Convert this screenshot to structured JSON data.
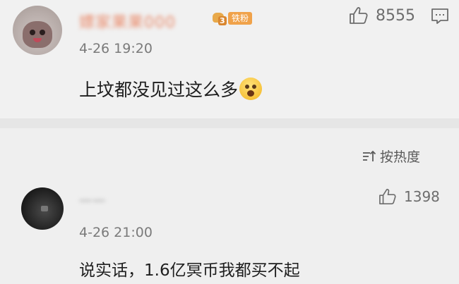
{
  "comments": [
    {
      "username": "嫖家果果000",
      "badge_level": "3",
      "badge_label": "铁粉",
      "time": "4-26 19:20",
      "text": "上坟都没见过这么多",
      "likes": "8555"
    },
    {
      "username": "一一",
      "time": "4-26 21:00",
      "text": "说实话，1.6亿冥币我都买不起",
      "likes": "1398"
    }
  ],
  "sort": {
    "label": "按热度"
  },
  "icons": {
    "like": "thumbs-up-icon",
    "more": "comment-menu-icon",
    "sort": "sort-icon",
    "emoji": "shocked-face-emoji",
    "badge": "fan-badge-icon"
  },
  "colors": {
    "background": "#efefef",
    "badge": "#f0a24a",
    "text": "#1e1e1e",
    "muted": "#7a7a7a"
  }
}
